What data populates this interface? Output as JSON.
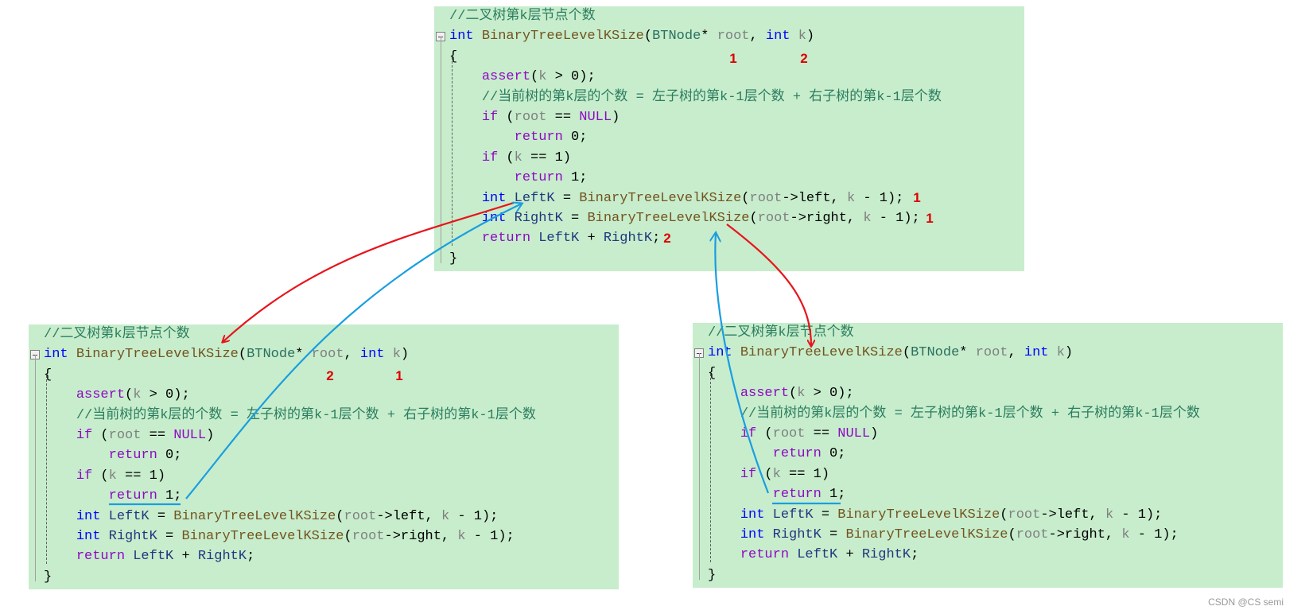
{
  "colors": {
    "background": "#c7edcc",
    "red_arrow": "#e8141c",
    "blue_arrow": "#1a9ee0",
    "annotation": "#e00000"
  },
  "blocks": [
    {
      "id": "top",
      "lines": [
        [
          [
            "cmt",
            "//二叉树第k层节点个数"
          ]
        ],
        [
          [
            "kw",
            "int"
          ],
          [
            "plain",
            " "
          ],
          [
            "fn",
            "BinaryTreeLevelKSize"
          ],
          [
            "plain",
            "("
          ],
          [
            "typ",
            "BTNode"
          ],
          [
            "plain",
            "* "
          ],
          [
            "param",
            "root"
          ],
          [
            "plain",
            ", "
          ],
          [
            "kw",
            "int"
          ],
          [
            "plain",
            " "
          ],
          [
            "param",
            "k"
          ],
          [
            "plain",
            ")"
          ]
        ],
        [
          [
            "plain",
            "{"
          ]
        ],
        [
          [
            "plain",
            "    "
          ],
          [
            "ctl",
            "assert"
          ],
          [
            "plain",
            "("
          ],
          [
            "param",
            "k"
          ],
          [
            "plain",
            " > 0);"
          ]
        ],
        [
          [
            "plain",
            "    "
          ],
          [
            "cmt",
            "//当前树的第k层的个数 = 左子树的第k-1层个数 + 右子树的第k-1层个数"
          ]
        ],
        [
          [
            "plain",
            "    "
          ],
          [
            "ctl",
            "if"
          ],
          [
            "plain",
            " ("
          ],
          [
            "param",
            "root"
          ],
          [
            "plain",
            " == "
          ],
          [
            "ctl",
            "NULL"
          ],
          [
            "plain",
            ")"
          ]
        ],
        [
          [
            "plain",
            "        "
          ],
          [
            "ctl",
            "return"
          ],
          [
            "plain",
            " 0;"
          ]
        ],
        [
          [
            "plain",
            "    "
          ],
          [
            "ctl",
            "if"
          ],
          [
            "plain",
            " ("
          ],
          [
            "param",
            "k"
          ],
          [
            "plain",
            " == 1)"
          ]
        ],
        [
          [
            "plain",
            "        "
          ],
          [
            "ctl",
            "return"
          ],
          [
            "plain",
            " 1;"
          ]
        ],
        [
          [
            "plain",
            "    "
          ],
          [
            "kw",
            "int"
          ],
          [
            "plain",
            " "
          ],
          [
            "var",
            "LeftK"
          ],
          [
            "plain",
            " = "
          ],
          [
            "fn",
            "BinaryTreeLevelKSize"
          ],
          [
            "plain",
            "("
          ],
          [
            "param",
            "root"
          ],
          [
            "plain",
            "->left, "
          ],
          [
            "param",
            "k"
          ],
          [
            "plain",
            " - 1);"
          ]
        ],
        [
          [
            "plain",
            "    "
          ],
          [
            "kw",
            "int"
          ],
          [
            "plain",
            " "
          ],
          [
            "var",
            "RightK"
          ],
          [
            "plain",
            " = "
          ],
          [
            "fn",
            "BinaryTreeLevelKSize"
          ],
          [
            "plain",
            "("
          ],
          [
            "param",
            "root"
          ],
          [
            "plain",
            "->right, "
          ],
          [
            "param",
            "k"
          ],
          [
            "plain",
            " - 1);"
          ]
        ],
        [
          [
            "plain",
            "    "
          ],
          [
            "ctl",
            "return"
          ],
          [
            "plain",
            " "
          ],
          [
            "var",
            "LeftK"
          ],
          [
            "plain",
            " + "
          ],
          [
            "var",
            "RightK"
          ],
          [
            "plain",
            ";"
          ]
        ],
        [
          [
            "plain",
            "}"
          ]
        ]
      ],
      "notes": [
        "1",
        "2",
        "1",
        "1",
        "2"
      ]
    },
    {
      "id": "bottom-left",
      "lines": [
        [
          [
            "cmt",
            "//二叉树第k层节点个数"
          ]
        ],
        [
          [
            "kw",
            "int"
          ],
          [
            "plain",
            " "
          ],
          [
            "fn",
            "BinaryTreeLevelKSize"
          ],
          [
            "plain",
            "("
          ],
          [
            "typ",
            "BTNode"
          ],
          [
            "plain",
            "* "
          ],
          [
            "param",
            "root"
          ],
          [
            "plain",
            ", "
          ],
          [
            "kw",
            "int"
          ],
          [
            "plain",
            " "
          ],
          [
            "param",
            "k"
          ],
          [
            "plain",
            ")"
          ]
        ],
        [
          [
            "plain",
            "{"
          ]
        ],
        [
          [
            "plain",
            "    "
          ],
          [
            "ctl",
            "assert"
          ],
          [
            "plain",
            "("
          ],
          [
            "param",
            "k"
          ],
          [
            "plain",
            " > 0);"
          ]
        ],
        [
          [
            "plain",
            "    "
          ],
          [
            "cmt",
            "//当前树的第k层的个数 = 左子树的第k-1层个数 + 右子树的第k-1层个数"
          ]
        ],
        [
          [
            "plain",
            "    "
          ],
          [
            "ctl",
            "if"
          ],
          [
            "plain",
            " ("
          ],
          [
            "param",
            "root"
          ],
          [
            "plain",
            " == "
          ],
          [
            "ctl",
            "NULL"
          ],
          [
            "plain",
            ")"
          ]
        ],
        [
          [
            "plain",
            "        "
          ],
          [
            "ctl",
            "return"
          ],
          [
            "plain",
            " 0;"
          ]
        ],
        [
          [
            "plain",
            "    "
          ],
          [
            "ctl",
            "if"
          ],
          [
            "plain",
            " ("
          ],
          [
            "param",
            "k"
          ],
          [
            "plain",
            " == 1)"
          ]
        ],
        [
          [
            "plain",
            "        "
          ],
          [
            "ctl",
            "return"
          ],
          [
            "plain",
            " 1;"
          ]
        ],
        [
          [
            "plain",
            "    "
          ],
          [
            "kw",
            "int"
          ],
          [
            "plain",
            " "
          ],
          [
            "var",
            "LeftK"
          ],
          [
            "plain",
            " = "
          ],
          [
            "fn",
            "BinaryTreeLevelKSize"
          ],
          [
            "plain",
            "("
          ],
          [
            "param",
            "root"
          ],
          [
            "plain",
            "->left, "
          ],
          [
            "param",
            "k"
          ],
          [
            "plain",
            " - 1);"
          ]
        ],
        [
          [
            "plain",
            "    "
          ],
          [
            "kw",
            "int"
          ],
          [
            "plain",
            " "
          ],
          [
            "var",
            "RightK"
          ],
          [
            "plain",
            " = "
          ],
          [
            "fn",
            "BinaryTreeLevelKSize"
          ],
          [
            "plain",
            "("
          ],
          [
            "param",
            "root"
          ],
          [
            "plain",
            "->right, "
          ],
          [
            "param",
            "k"
          ],
          [
            "plain",
            " - 1);"
          ]
        ],
        [
          [
            "plain",
            "    "
          ],
          [
            "ctl",
            "return"
          ],
          [
            "plain",
            " "
          ],
          [
            "var",
            "LeftK"
          ],
          [
            "plain",
            " + "
          ],
          [
            "var",
            "RightK"
          ],
          [
            "plain",
            ";"
          ]
        ],
        [
          [
            "plain",
            "}"
          ]
        ]
      ],
      "notes": [
        "2",
        "1"
      ]
    },
    {
      "id": "bottom-right",
      "lines": [
        [
          [
            "cmt",
            "//二叉树第k层节点个数"
          ]
        ],
        [
          [
            "kw",
            "int"
          ],
          [
            "plain",
            " "
          ],
          [
            "fn",
            "BinaryTreeLevelKSize"
          ],
          [
            "plain",
            "("
          ],
          [
            "typ",
            "BTNode"
          ],
          [
            "plain",
            "* "
          ],
          [
            "param",
            "root"
          ],
          [
            "plain",
            ", "
          ],
          [
            "kw",
            "int"
          ],
          [
            "plain",
            " "
          ],
          [
            "param",
            "k"
          ],
          [
            "plain",
            ")"
          ]
        ],
        [
          [
            "plain",
            "{"
          ]
        ],
        [
          [
            "plain",
            "    "
          ],
          [
            "ctl",
            "assert"
          ],
          [
            "plain",
            "("
          ],
          [
            "param",
            "k"
          ],
          [
            "plain",
            " > 0);"
          ]
        ],
        [
          [
            "plain",
            "    "
          ],
          [
            "cmt",
            "//当前树的第k层的个数 = 左子树的第k-1层个数 + 右子树的第k-1层个数"
          ]
        ],
        [
          [
            "plain",
            "    "
          ],
          [
            "ctl",
            "if"
          ],
          [
            "plain",
            " ("
          ],
          [
            "param",
            "root"
          ],
          [
            "plain",
            " == "
          ],
          [
            "ctl",
            "NULL"
          ],
          [
            "plain",
            ")"
          ]
        ],
        [
          [
            "plain",
            "        "
          ],
          [
            "ctl",
            "return"
          ],
          [
            "plain",
            " 0;"
          ]
        ],
        [
          [
            "plain",
            "    "
          ],
          [
            "ctl",
            "if"
          ],
          [
            "plain",
            " ("
          ],
          [
            "param",
            "k"
          ],
          [
            "plain",
            " == 1)"
          ]
        ],
        [
          [
            "plain",
            "        "
          ],
          [
            "ctl",
            "return"
          ],
          [
            "plain",
            " 1;"
          ]
        ],
        [
          [
            "plain",
            "    "
          ],
          [
            "kw",
            "int"
          ],
          [
            "plain",
            " "
          ],
          [
            "var",
            "LeftK"
          ],
          [
            "plain",
            " = "
          ],
          [
            "fn",
            "BinaryTreeLevelKSize"
          ],
          [
            "plain",
            "("
          ],
          [
            "param",
            "root"
          ],
          [
            "plain",
            "->left, "
          ],
          [
            "param",
            "k"
          ],
          [
            "plain",
            " - 1);"
          ]
        ],
        [
          [
            "plain",
            "    "
          ],
          [
            "kw",
            "int"
          ],
          [
            "plain",
            " "
          ],
          [
            "var",
            "RightK"
          ],
          [
            "plain",
            " = "
          ],
          [
            "fn",
            "BinaryTreeLevelKSize"
          ],
          [
            "plain",
            "("
          ],
          [
            "param",
            "root"
          ],
          [
            "plain",
            "->right, "
          ],
          [
            "param",
            "k"
          ],
          [
            "plain",
            " - 1);"
          ]
        ],
        [
          [
            "plain",
            "    "
          ],
          [
            "ctl",
            "return"
          ],
          [
            "plain",
            " "
          ],
          [
            "var",
            "LeftK"
          ],
          [
            "plain",
            " + "
          ],
          [
            "var",
            "RightK"
          ],
          [
            "plain",
            ";"
          ]
        ],
        [
          [
            "plain",
            "}"
          ]
        ]
      ],
      "notes": []
    }
  ],
  "watermark": "CSDN @CS semi"
}
